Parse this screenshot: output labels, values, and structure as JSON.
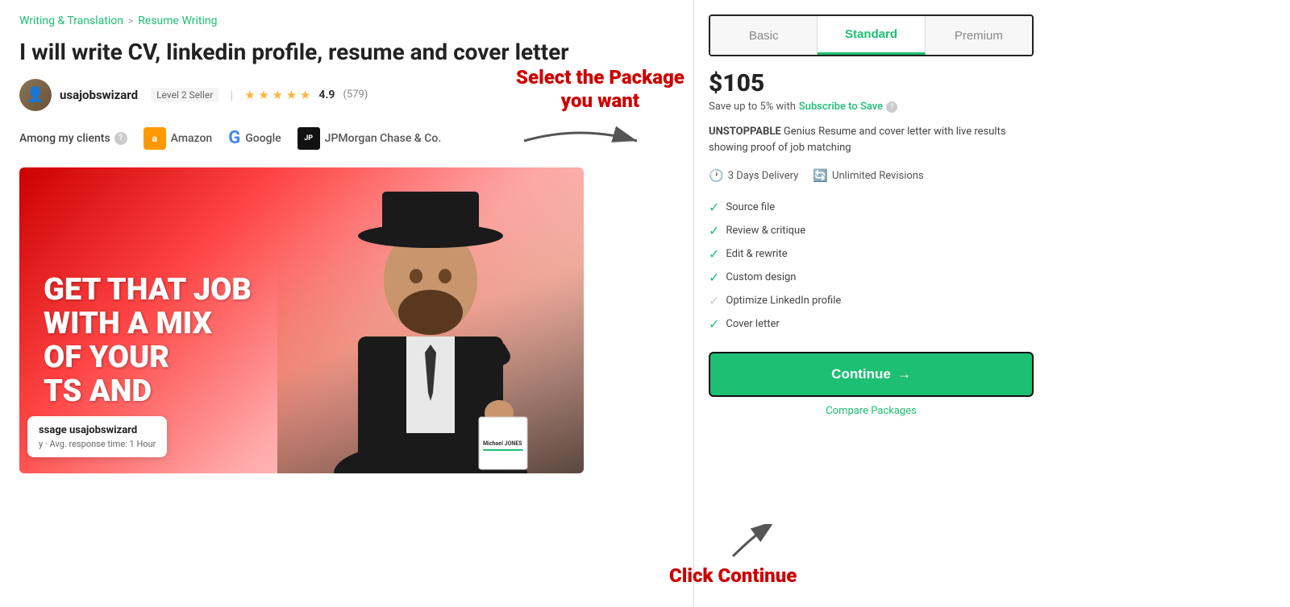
{
  "breadcrumb": {
    "writing": "Writing & Translation",
    "separator": ">",
    "resume": "Resume Writing"
  },
  "gig": {
    "title": "I will write CV, linkedin profile, resume and cover letter",
    "seller": {
      "name": "usajobswizard",
      "level": "Level 2 Seller",
      "rating": "4.9",
      "reviewCount": "(579)"
    },
    "clients": {
      "label": "Among my clients",
      "list": [
        "Amazon",
        "Google",
        "JPMorgan Chase & Co."
      ]
    },
    "imageText": "GET THAT JOB\nWITH A MIX\nOF YOUR\nTS AND"
  },
  "messageBubble": {
    "name": "ssage usajobswizard",
    "detail": "y · Avg. response time: 1 Hour"
  },
  "packagePanel": {
    "tabs": [
      "Basic",
      "Standard",
      "Premium"
    ],
    "activeTab": "Standard",
    "price": "$105",
    "subscribeSave": "Save up to 5% with Subscribe to Save",
    "description": "UNSTOPPABLE Genius Resume and cover letter with live results showing proof of job matching",
    "delivery": "3 Days Delivery",
    "revisions": "Unlimited Revisions",
    "features": [
      {
        "label": "Source file",
        "enabled": true
      },
      {
        "label": "Review & critique",
        "enabled": true
      },
      {
        "label": "Edit & rewrite",
        "enabled": true
      },
      {
        "label": "Custom design",
        "enabled": true
      },
      {
        "label": "Optimize LinkedIn profile",
        "enabled": false
      },
      {
        "label": "Cover letter",
        "enabled": true
      }
    ],
    "continueBtn": "Continue",
    "compareLink": "Compare Packages"
  },
  "annotations": {
    "selectPackage": "Select the Package\nyou want",
    "clickContinue": "Click Continue"
  }
}
